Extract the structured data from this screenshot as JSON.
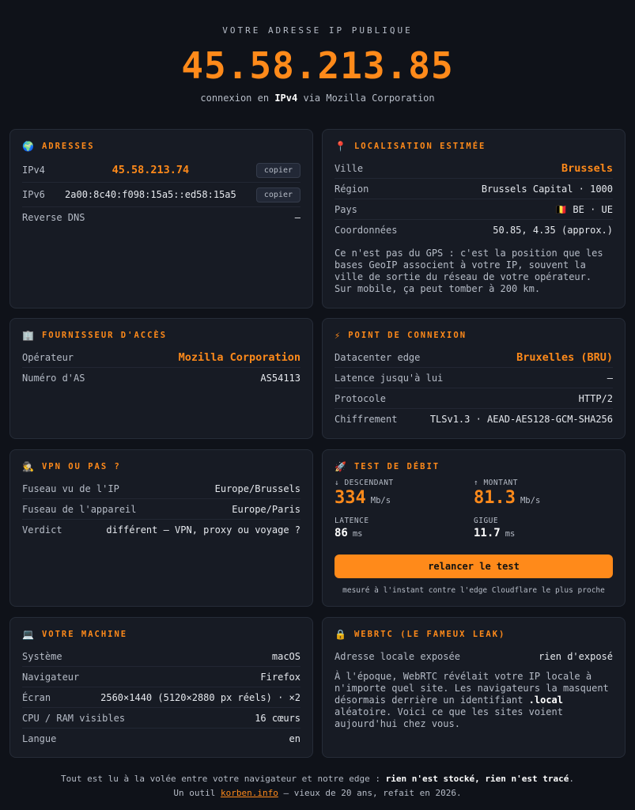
{
  "hero": {
    "kicker": "VOTRE ADRESSE IP PUBLIQUE",
    "ip": "45.58.213.85",
    "sub_prefix": "connexion en",
    "sub_proto": "IPv4",
    "sub_suffix": "via Mozilla Corporation"
  },
  "addresses": {
    "icon": "🌍",
    "title": "ADRESSES",
    "ipv4_label": "IPv4",
    "ipv4_value": "45.58.213.74",
    "ipv6_label": "IPv6",
    "ipv6_value": "2a00:8c40:f098:15a5::ed58:15a5",
    "copy_label": "copier",
    "rdns_label": "Reverse DNS",
    "rdns_value": "—"
  },
  "location": {
    "icon": "📍",
    "title": "LOCALISATION ESTIMÉE",
    "ville_label": "Ville",
    "ville_value": "Brussels",
    "region_label": "Région",
    "region_value": "Brussels Capital · 1000",
    "pays_label": "Pays",
    "pays_flag": "🇧🇪",
    "pays_value": "BE · UE",
    "coords_label": "Coordonnées",
    "coords_value": "50.85, 4.35 (approx.)",
    "note": "Ce n'est pas du GPS : c'est la position que les bases GeoIP associent à votre IP, souvent la ville de sortie du réseau de votre opérateur. Sur mobile, ça peut tomber à 200 km."
  },
  "isp": {
    "icon": "🏢",
    "title": "FOURNISSEUR D'ACCÈS",
    "op_label": "Opérateur",
    "op_value": "Mozilla Corporation",
    "as_label": "Numéro d'AS",
    "as_value": "AS54113"
  },
  "connection": {
    "icon": "⚡",
    "title": "POINT DE CONNEXION",
    "dc_label": "Datacenter edge",
    "dc_value": "Bruxelles (BRU)",
    "lat_label": "Latence jusqu'à lui",
    "lat_value": "—",
    "proto_label": "Protocole",
    "proto_value": "HTTP/2",
    "cipher_label": "Chiffrement",
    "cipher_value": "TLSv1.3 · AEAD-AES128-GCM-SHA256"
  },
  "vpn": {
    "icon": "🕵",
    "title": "VPN OU PAS ?",
    "tz_ip_label": "Fuseau vu de l'IP",
    "tz_ip_value": "Europe/Brussels",
    "tz_dev_label": "Fuseau de l'appareil",
    "tz_dev_value": "Europe/Paris",
    "verdict_label": "Verdict",
    "verdict_value": "différent — VPN, proxy ou voyage ?"
  },
  "speed": {
    "icon": "🚀",
    "title": "TEST DE DÉBIT",
    "down_label": "↓ DESCENDANT",
    "down_value": "334",
    "down_unit": "Mb/s",
    "up_label": "↑ MONTANT",
    "up_value": "81.3",
    "up_unit": "Mb/s",
    "latency_label": "LATENCE",
    "latency_value": "86",
    "latency_unit": "ms",
    "jitter_label": "GIGUE",
    "jitter_value": "11.7",
    "jitter_unit": "ms",
    "button": "relancer le test",
    "caption": "mesuré à l'instant contre l'edge Cloudflare le plus proche"
  },
  "machine": {
    "icon": "💻",
    "title": "VOTRE MACHINE",
    "os_label": "Système",
    "os_value": "macOS",
    "browser_label": "Navigateur",
    "browser_value": "Firefox",
    "screen_label": "Écran",
    "screen_value": "2560×1440 (5120×2880 px réels) · ×2",
    "cpu_label": "CPU / RAM visibles",
    "cpu_value": "16 cœurs",
    "lang_label": "Langue",
    "lang_value": "en"
  },
  "webrtc": {
    "icon": "🔒",
    "title": "WEBRTC (LE FAMEUX LEAK)",
    "local_label": "Adresse locale exposée",
    "local_value": "rien d'exposé",
    "note_a": "À l'époque, WebRTC révélait votre IP locale à n'importe quel site. Les navigateurs la masquent désormais derrière un identifiant",
    "note_b": ".local",
    "note_c": "aléatoire. Voici ce que les sites voient aujourd'hui chez vous."
  },
  "footer": {
    "line1_prefix": "Tout est lu à la volée entre votre navigateur et notre edge :",
    "line1_bold": "rien n'est stocké, rien n'est tracé",
    "line1_suffix": ".",
    "line2_prefix": "Un outil",
    "line2_link": "korben.info",
    "line2_suffix": "— vieux de 20 ans, refait en 2026."
  },
  "colors": {
    "accent": "#ff8a1a",
    "background": "#0f1219",
    "card": "#171b24"
  }
}
